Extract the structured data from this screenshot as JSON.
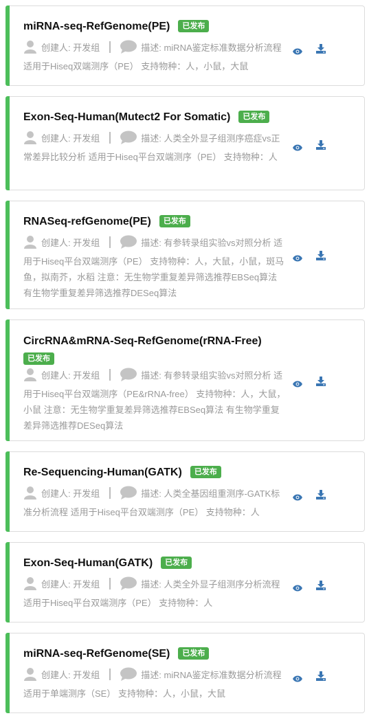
{
  "creator_label": "创建人: 开发组",
  "desc_prefix": "描述: ",
  "badge_label": "已发布",
  "icons": {
    "creator": "user-icon",
    "description": "comment-icon",
    "view": "eye-icon",
    "download": "download-icon"
  },
  "colors": {
    "accent_bar": "#4cbe5a",
    "badge": "#4cae4c",
    "icon": "#3a76b3"
  },
  "pipelines": [
    {
      "title": "miRNA-seq-RefGenome(PE)",
      "desc": "miRNA鉴定标准数据分析流程 适用于Hiseq双端测序（PE） 支持物种：人，小鼠，大鼠"
    },
    {
      "title": "Exon-Seq-Human(Mutect2 For Somatic)",
      "desc": "人类全外显子组测序癌症vs正常差异比较分析 适用于Hiseq平台双端测序（PE） 支持物种：人"
    },
    {
      "title": "RNASeq-refGenome(PE)",
      "desc": "有参转录组实验vs对照分析 适用于Hiseq平台双端测序（PE） 支持物种：人，大鼠，小鼠，斑马鱼，拟南芥，水稻 注意：无生物学重复差异筛选推荐EBSeq算法 有生物学重复差异筛选推荐DESeq算法"
    },
    {
      "title": "CircRNA&mRNA-Seq-RefGenome(rRNA-Free)",
      "desc": "有参转录组实验vs对照分析 适用于Hiseq平台双端测序（PE&rRNA-free） 支持物种：人，大鼠，小鼠 注意：无生物学重复差异筛选推荐EBSeq算法 有生物学重复差异筛选推荐DESeq算法"
    },
    {
      "title": "Re-Sequencing-Human(GATK)",
      "desc": "人类全基因组重测序-GATK标准分析流程 适用于Hiseq平台双端测序（PE） 支持物种：人"
    },
    {
      "title": "Exon-Seq-Human(GATK)",
      "desc": "人类全外显子组测序分析流程 适用于Hiseq平台双端测序（PE） 支持物种：人"
    },
    {
      "title": "miRNA-seq-RefGenome(SE)",
      "desc": "miRNA鉴定标准数据分析流程 适用于单端测序（SE） 支持物种：人，小鼠，大鼠"
    }
  ]
}
